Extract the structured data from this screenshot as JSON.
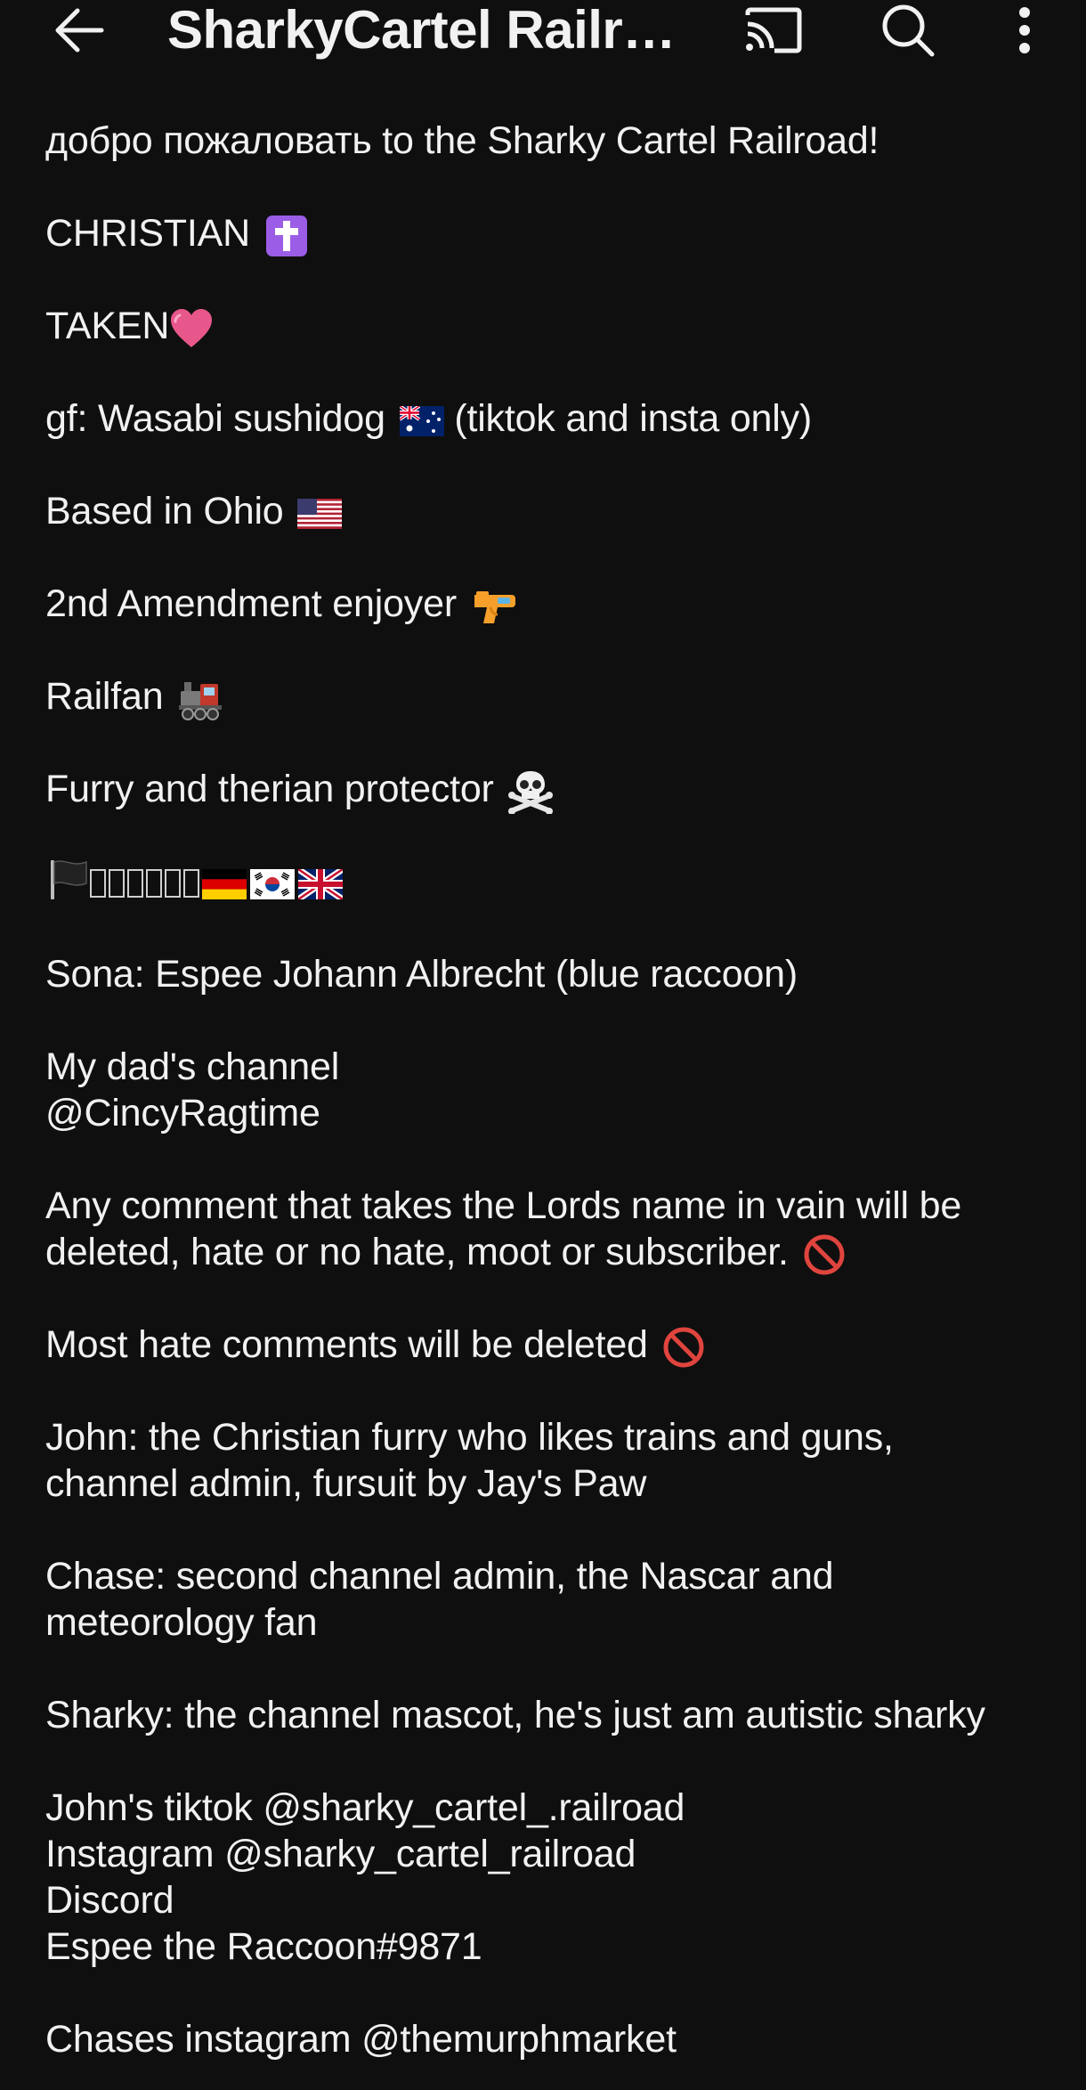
{
  "app_bar": {
    "title": "SharkyCartel Railro...",
    "icons": [
      "back-arrow-icon",
      "cast-icon",
      "search-icon",
      "more-vertical-icon"
    ]
  },
  "description": {
    "welcome": "добро пожаловать to the Sharky Cartel Railroad!",
    "christian": "CHRISTIAN",
    "taken": "TAKEN",
    "gf": "gf: Wasabi sushidog",
    "gf_suffix": "(tiktok and insta only)",
    "based": "Based in Ohio",
    "amendment": "2nd Amendment enjoyer",
    "railfan": "Railfan",
    "furry": "Furry and therian protector",
    "sona": "Sona: Espee Johann Albrecht (blue raccoon)",
    "dad_channel": "My dad's channel",
    "dad_handle": "@CincyRagtime",
    "comment_rule_1": "Any comment that takes the Lords name in vain will be",
    "comment_rule_2": "deleted, hate or no hate, moot or subscriber.",
    "hate_rule": "Most hate comments will be deleted",
    "john_1": "John: the Christian furry who likes trains and guns,",
    "john_2": "channel admin, fursuit by Jay's Paw",
    "chase_1": "Chase: second channel admin, the Nascar and",
    "chase_2": "meteorology fan",
    "sharky": "Sharky: the channel mascot, he's just am autistic sharky",
    "tiktok": "John's tiktok @sharky_cartel_.railroad",
    "instagram": "Instagram @sharky_cartel_railroad",
    "discord": "Discord",
    "discord_tag": "Espee the Raccoon#9871",
    "chase_instagram": "Chases instagram @themurphmarket"
  },
  "colors": {
    "background": "#0f0f0f",
    "text": "#f1f1f1",
    "heart": "#e8578b",
    "prohibited": "#e0443e",
    "cross_bg": "#9b5de5"
  }
}
